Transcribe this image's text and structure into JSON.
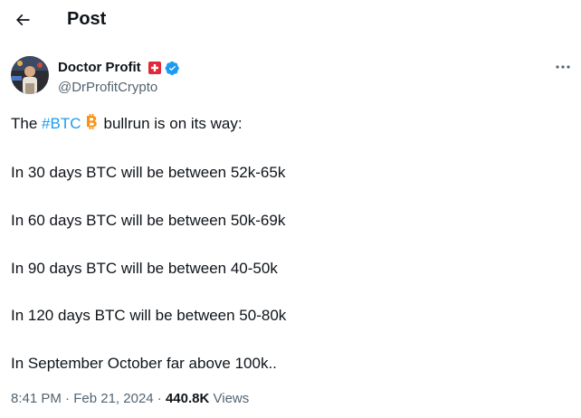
{
  "header": {
    "back_icon": "arrow-left-icon",
    "title": "Post"
  },
  "author": {
    "display_name": "Doctor Profit",
    "handle": "@DrProfitCrypto",
    "badges": [
      "swiss-flag-icon",
      "verified-badge-icon"
    ],
    "verified_color": "#1d9bf0"
  },
  "menu": {
    "icon": "more-horizontal-icon"
  },
  "tweet": {
    "line1_prefix": "The ",
    "hashtag": "#BTC",
    "hashtag_icon": "bitcoin-icon",
    "line1_suffix": "bullrun is on its way:",
    "lines": [
      "In 30 days BTC will be between 52k-65k",
      "In 60 days BTC will be between 50k-69k",
      "In 90 days BTC will be between 40-50k",
      "In 120 days BTC will be between 50-80k",
      "In September October far above 100k.."
    ]
  },
  "meta": {
    "time": "8:41 PM",
    "separator": "·",
    "date": "Feb 21, 2024",
    "views_count": "440.8K",
    "views_label": "Views"
  },
  "colors": {
    "accent": "#1d9bf0",
    "bitcoin": "#f7931a",
    "text": "#0f1419",
    "secondary": "#536471"
  }
}
